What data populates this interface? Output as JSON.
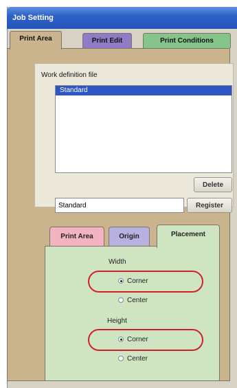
{
  "window": {
    "title": "Job Setting"
  },
  "outer_tabs": [
    {
      "label": "Print Area",
      "active": true
    },
    {
      "label": "Print Edit",
      "color": "#8e7cc6"
    },
    {
      "label": "Print Conditions",
      "color": "#86c58a"
    }
  ],
  "work_definition": {
    "label": "Work definition file",
    "list_items": [
      {
        "label": "Standard",
        "selected": true
      }
    ],
    "delete_label": "Delete",
    "name_value": "Standard",
    "register_label": "Register"
  },
  "inner_tabs": [
    {
      "label": "Print Area",
      "color": "#f4b3c0"
    },
    {
      "label": "Origin",
      "color": "#b7b1df"
    },
    {
      "label": "Placement",
      "active": true
    }
  ],
  "placement": {
    "width_label": "Width",
    "width_options": [
      {
        "label": "Corner",
        "selected": true
      },
      {
        "label": "Center",
        "selected": false
      }
    ],
    "height_label": "Height",
    "height_options": [
      {
        "label": "Corner",
        "selected": true
      },
      {
        "label": "Center",
        "selected": false
      }
    ]
  },
  "colors": {
    "highlight": "#d0202e",
    "title_bar": "#2f62c9",
    "selection": "#2e55c4"
  }
}
